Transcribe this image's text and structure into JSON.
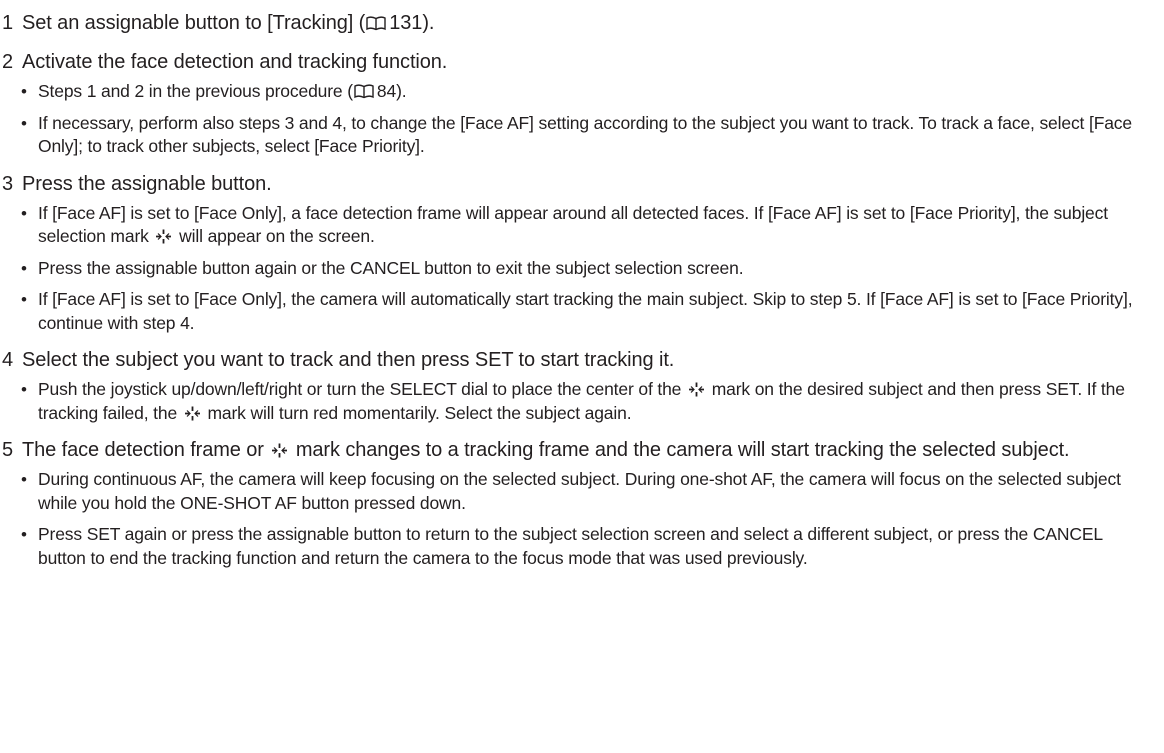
{
  "steps": [
    {
      "number": "1",
      "head_before": "Set an assignable button to [Tracking] (",
      "head_ref": "131",
      "head_after": ").",
      "bullets": []
    },
    {
      "number": "2",
      "head": "Activate the face detection and tracking function.",
      "bullets": [
        {
          "before": "Steps 1 and 2 in the previous procedure (",
          "ref": "84",
          "after": ")."
        },
        {
          "text": "If necessary, perform also steps 3 and 4, to change the [Face AF] setting according to the subject you want to track. To track a face, select [Face Only]; to track other subjects, select [Face Priority]."
        }
      ]
    },
    {
      "number": "3",
      "head": "Press the assignable button.",
      "bullets": [
        {
          "before": "If [Face AF] is set to [Face Only], a face detection frame will appear around all detected faces. If [Face AF] is set to [Face Priority], the subject selection mark",
          "after": "will appear on the screen."
        },
        {
          "text": "Press the assignable button again or the CANCEL button to exit the subject selection screen."
        },
        {
          "text": "If [Face AF] is set to [Face Only], the camera will automatically start tracking the main subject. Skip to step 5. If [Face AF] is set to [Face Priority], continue with step 4."
        }
      ]
    },
    {
      "number": "4",
      "head": "Select the subject you want to track and then press SET to start tracking it.",
      "bullets": [
        {
          "part1": "Push the joystick up/down/left/right or turn the SELECT dial to place the center of the",
          "part2": "mark on the desired subject and then press SET. If the tracking failed, the",
          "part3": "mark will turn red momentarily. Select the subject again."
        }
      ]
    },
    {
      "number": "5",
      "head_before": "The face detection frame or",
      "head_after": "mark changes to a tracking frame and the camera will start tracking the selected subject.",
      "bullets": [
        {
          "text": "During continuous AF, the camera will keep focusing on the selected subject. During one-shot AF, the camera will focus on the selected subject while you hold the ONE-SHOT AF button pressed down."
        },
        {
          "text": "Press SET again or press the assignable button to return to the subject selection screen and select a different subject, or press the CANCEL button to end the tracking function and return the camera to the focus mode that was used previously."
        }
      ]
    }
  ],
  "icons": {
    "reference": "book-reference-icon",
    "subject_mark": "subject-selection-mark-icon",
    "bullet": "•"
  }
}
